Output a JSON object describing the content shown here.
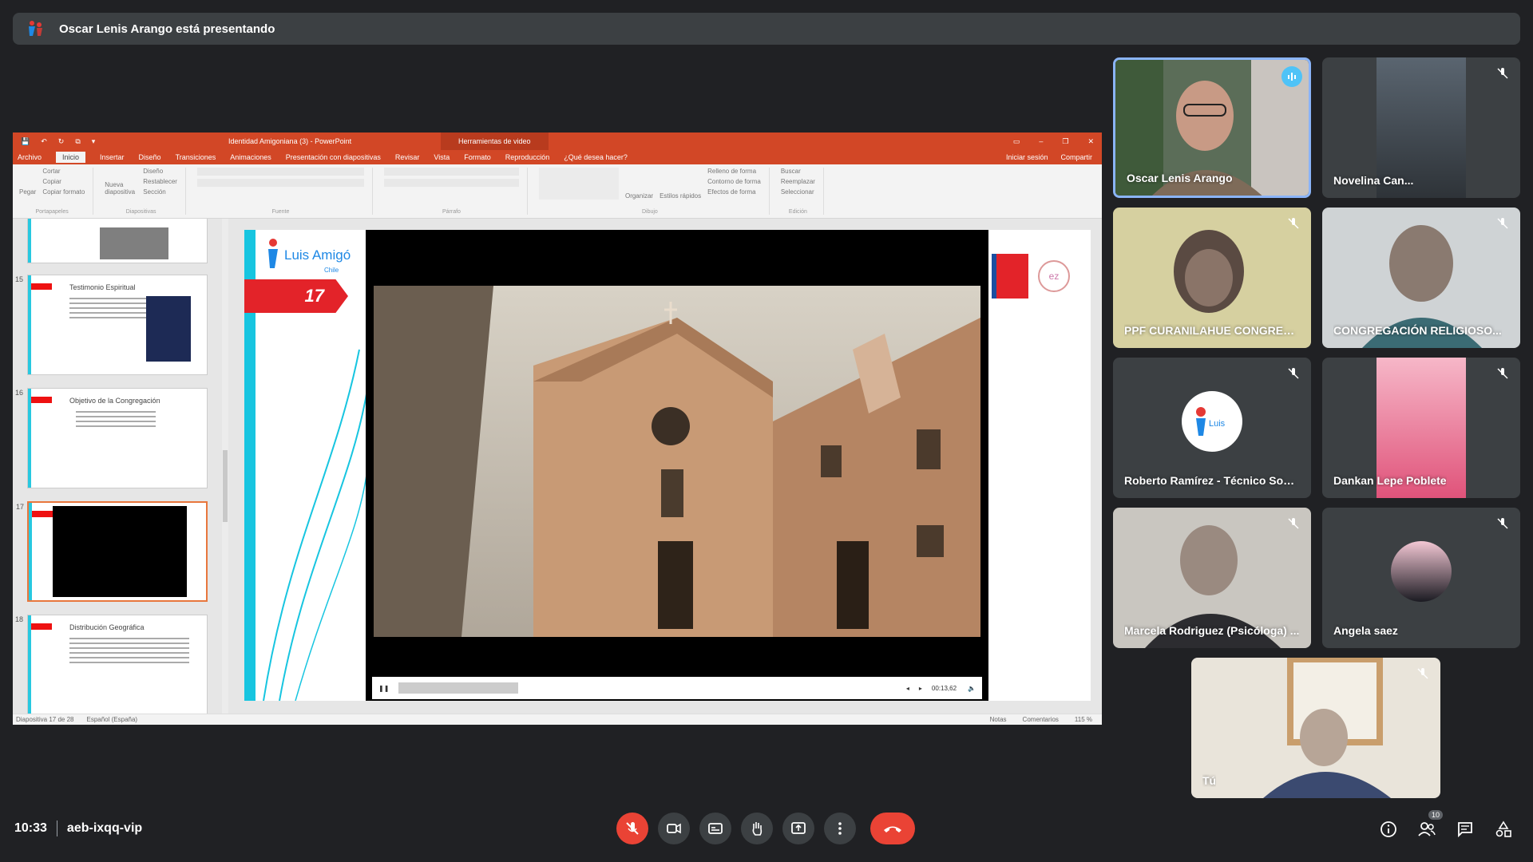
{
  "banner": {
    "text": "Oscar Lenis Arango está presentando"
  },
  "ppt": {
    "quick_access": [
      "💾",
      "↶",
      "↻",
      "⧉",
      "▾"
    ],
    "doc_title": "Identidad Amigoniana (3) - PowerPoint",
    "tools_label": "Herramientas de video",
    "window_buttons": [
      "▭",
      "–",
      "❐",
      "✕"
    ],
    "menu": [
      "Archivo",
      "Inicio",
      "Insertar",
      "Diseño",
      "Transiciones",
      "Animaciones",
      "Presentación con diapositivas",
      "Revisar",
      "Vista",
      "Formato",
      "Reproducción",
      "¿Qué desea hacer?"
    ],
    "menu_right": [
      "Iniciar sesión",
      "Compartir"
    ],
    "ribbon": {
      "clipboard": [
        "Cortar",
        "Copiar",
        "Copiar formato"
      ],
      "clipboard_main": "Pegar",
      "clipboard_group": "Portapapeles",
      "slides": [
        "Diseño",
        "Restablecer",
        "Sección"
      ],
      "slides_main": "Nueva diapositiva",
      "slides_group": "Diapositivas",
      "font_group": "Fuente",
      "paragraph_group": "Párrafo",
      "drawing": [
        "Relleno de forma",
        "Contorno de forma",
        "Efectos de forma"
      ],
      "drawing_main": [
        "Organizar",
        "Estilos rápidos"
      ],
      "drawing_group": "Dibujo",
      "editing": [
        "Buscar",
        "Reemplazar",
        "Seleccionar"
      ],
      "editing_group": "Edición"
    },
    "thumbs": [
      {
        "num": "15",
        "title": "Testimonio Espiritual"
      },
      {
        "num": "16",
        "title": "Objetivo de la Congregación"
      },
      {
        "num": "17",
        "title": ""
      },
      {
        "num": "18",
        "title": "Distribución Geográfica"
      }
    ],
    "slide_badge": "17",
    "slide_logo": "Luis Amigó",
    "slide_logo_sub": "Chile",
    "video_time": "00:13,62",
    "status_left": [
      "Diapositiva 17 de 28",
      "Español (España)"
    ],
    "status_right": [
      "Notas",
      "Comentarios",
      "115 %"
    ]
  },
  "participants": [
    {
      "name": "Oscar Lenis Arango",
      "speaking": true
    },
    {
      "name": "Novelina Can...",
      "muted": true
    },
    {
      "name": "PPF CURANILAHUE CONGREG...",
      "muted": true
    },
    {
      "name": "CONGREGACIÓN RELIGIOSO...",
      "muted": true
    },
    {
      "name": "Roberto Ramírez - Técnico Soci...",
      "muted": true
    },
    {
      "name": "Dankan Lepe Poblete",
      "muted": true
    },
    {
      "name": "Marcela Rodriguez (Psicóloga) ...",
      "muted": true
    },
    {
      "name": "Angela saez",
      "muted": true
    },
    {
      "name": "Tú",
      "muted": true
    }
  ],
  "meeting": {
    "time": "10:33",
    "code": "aeb-ixqq-vip",
    "participant_count": "10"
  },
  "colors": {
    "background": "#202124",
    "tile": "#3c4043",
    "end_call": "#ea4335",
    "ppt_accent": "#d24726"
  }
}
